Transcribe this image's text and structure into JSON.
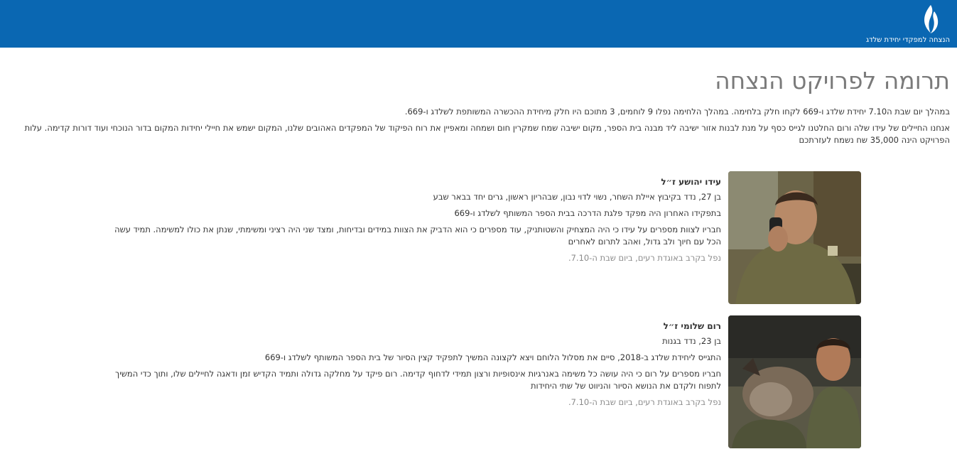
{
  "header": {
    "logo_text": "הנצחה למפקדי יחידת שלדג",
    "brand_color": "#0a67b2"
  },
  "page": {
    "title": "תרומה לפרויקט הנצחה",
    "intro": [
      "במהלך יום שבת ה7.10 יחידת שלדג ו-669 לקחו חלק בלחימה. במהלך הלחימה נפלו 9 לוחמים, 3 מתוכם היו חלק מיחידת ההכשרה המשותפת לשלדג ו-669.",
      "אנחנו החיילים של עידו שלה ורום החלטנו לגייס כסף על מנת לבנות אזור ישיבה ליד מבנה בית הספר, מקום ישיבה שמח שמקרין חום ושמחה ומאפיין את רוח הפיקוד של המפקדים האהובים שלנו, המקום ישמש את חיילי יחידות המקום בדור הנוכחי ועוד דורות קדימה. עלות הפרויקט הינה 35,000 שח נשמח לעזרתכם"
    ]
  },
  "fallen": [
    {
      "name": "עידו יהושע ז״ל",
      "bio": "בן 27, נדד בקיבוץ איילת השחר, נשוי לדוי נבון, שבהריון ראשון, גרים יחד בבאר שבע",
      "role": "בתפקידו האחרון היה מפקד פלגת הדרכה בבית הספר המשותף לשלדג ו-669",
      "story": "חבריו לצוות מספרים על עידו כי היה המצחיק והשטותניק, עוד מספרים כי הוא הדביק את הצוות במידים ובדיחות, ומצד שני היה רציני ומשימתי, שנתן את כולו למשימה. תמיד עשה הכל עם חיוך ולב גדול, ואהב לתרום לאחרים",
      "fell": "נפל בקרב באוגדת רעים, ביום שבת ה-7.10."
    },
    {
      "name": "רום שלומי ז״ל",
      "bio": "בן 23, נדד בגנות",
      "role": "התגייס ליחידת שלדג ב-2018, סיים את מסלול הלוחם ויצא לקצונה המשיך לתפקיד קצין הסיור של בית הספר המשותף לשלדג ו-669",
      "story": "חבריו מספרים על רום כי היה עושה כל משימה באנרגיות אינסופיות ורצון תמידי לדחוף קדימה. רום פיקד על מחלקה גדולה ותמיד הקדיש זמן ודאגה לחיילים שלו, ותוך כדי המשיך לתפוח ולקדם את הנושא הסיור והניווט של שתי היחידות",
      "fell": "נפל בקרב באוגדת רעים, ביום שבת ה-7.10."
    }
  ]
}
